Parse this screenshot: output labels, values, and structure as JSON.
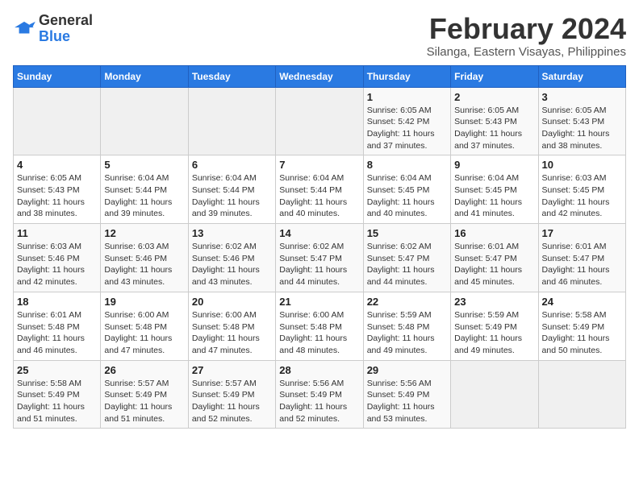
{
  "logo": {
    "line1": "General",
    "line2": "Blue"
  },
  "title": "February 2024",
  "subtitle": "Silanga, Eastern Visayas, Philippines",
  "days_header": [
    "Sunday",
    "Monday",
    "Tuesday",
    "Wednesday",
    "Thursday",
    "Friday",
    "Saturday"
  ],
  "weeks": [
    [
      {
        "day": "",
        "info": ""
      },
      {
        "day": "",
        "info": ""
      },
      {
        "day": "",
        "info": ""
      },
      {
        "day": "",
        "info": ""
      },
      {
        "day": "1",
        "info": "Sunrise: 6:05 AM\nSunset: 5:42 PM\nDaylight: 11 hours and 37 minutes."
      },
      {
        "day": "2",
        "info": "Sunrise: 6:05 AM\nSunset: 5:43 PM\nDaylight: 11 hours and 37 minutes."
      },
      {
        "day": "3",
        "info": "Sunrise: 6:05 AM\nSunset: 5:43 PM\nDaylight: 11 hours and 38 minutes."
      }
    ],
    [
      {
        "day": "4",
        "info": "Sunrise: 6:05 AM\nSunset: 5:43 PM\nDaylight: 11 hours and 38 minutes."
      },
      {
        "day": "5",
        "info": "Sunrise: 6:04 AM\nSunset: 5:44 PM\nDaylight: 11 hours and 39 minutes."
      },
      {
        "day": "6",
        "info": "Sunrise: 6:04 AM\nSunset: 5:44 PM\nDaylight: 11 hours and 39 minutes."
      },
      {
        "day": "7",
        "info": "Sunrise: 6:04 AM\nSunset: 5:44 PM\nDaylight: 11 hours and 40 minutes."
      },
      {
        "day": "8",
        "info": "Sunrise: 6:04 AM\nSunset: 5:45 PM\nDaylight: 11 hours and 40 minutes."
      },
      {
        "day": "9",
        "info": "Sunrise: 6:04 AM\nSunset: 5:45 PM\nDaylight: 11 hours and 41 minutes."
      },
      {
        "day": "10",
        "info": "Sunrise: 6:03 AM\nSunset: 5:45 PM\nDaylight: 11 hours and 42 minutes."
      }
    ],
    [
      {
        "day": "11",
        "info": "Sunrise: 6:03 AM\nSunset: 5:46 PM\nDaylight: 11 hours and 42 minutes."
      },
      {
        "day": "12",
        "info": "Sunrise: 6:03 AM\nSunset: 5:46 PM\nDaylight: 11 hours and 43 minutes."
      },
      {
        "day": "13",
        "info": "Sunrise: 6:02 AM\nSunset: 5:46 PM\nDaylight: 11 hours and 43 minutes."
      },
      {
        "day": "14",
        "info": "Sunrise: 6:02 AM\nSunset: 5:47 PM\nDaylight: 11 hours and 44 minutes."
      },
      {
        "day": "15",
        "info": "Sunrise: 6:02 AM\nSunset: 5:47 PM\nDaylight: 11 hours and 44 minutes."
      },
      {
        "day": "16",
        "info": "Sunrise: 6:01 AM\nSunset: 5:47 PM\nDaylight: 11 hours and 45 minutes."
      },
      {
        "day": "17",
        "info": "Sunrise: 6:01 AM\nSunset: 5:47 PM\nDaylight: 11 hours and 46 minutes."
      }
    ],
    [
      {
        "day": "18",
        "info": "Sunrise: 6:01 AM\nSunset: 5:48 PM\nDaylight: 11 hours and 46 minutes."
      },
      {
        "day": "19",
        "info": "Sunrise: 6:00 AM\nSunset: 5:48 PM\nDaylight: 11 hours and 47 minutes."
      },
      {
        "day": "20",
        "info": "Sunrise: 6:00 AM\nSunset: 5:48 PM\nDaylight: 11 hours and 47 minutes."
      },
      {
        "day": "21",
        "info": "Sunrise: 6:00 AM\nSunset: 5:48 PM\nDaylight: 11 hours and 48 minutes."
      },
      {
        "day": "22",
        "info": "Sunrise: 5:59 AM\nSunset: 5:48 PM\nDaylight: 11 hours and 49 minutes."
      },
      {
        "day": "23",
        "info": "Sunrise: 5:59 AM\nSunset: 5:49 PM\nDaylight: 11 hours and 49 minutes."
      },
      {
        "day": "24",
        "info": "Sunrise: 5:58 AM\nSunset: 5:49 PM\nDaylight: 11 hours and 50 minutes."
      }
    ],
    [
      {
        "day": "25",
        "info": "Sunrise: 5:58 AM\nSunset: 5:49 PM\nDaylight: 11 hours and 51 minutes."
      },
      {
        "day": "26",
        "info": "Sunrise: 5:57 AM\nSunset: 5:49 PM\nDaylight: 11 hours and 51 minutes."
      },
      {
        "day": "27",
        "info": "Sunrise: 5:57 AM\nSunset: 5:49 PM\nDaylight: 11 hours and 52 minutes."
      },
      {
        "day": "28",
        "info": "Sunrise: 5:56 AM\nSunset: 5:49 PM\nDaylight: 11 hours and 52 minutes."
      },
      {
        "day": "29",
        "info": "Sunrise: 5:56 AM\nSunset: 5:49 PM\nDaylight: 11 hours and 53 minutes."
      },
      {
        "day": "",
        "info": ""
      },
      {
        "day": "",
        "info": ""
      }
    ]
  ]
}
